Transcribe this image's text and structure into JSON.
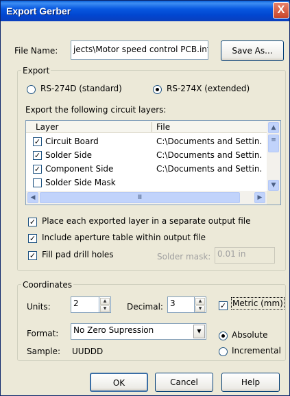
{
  "window": {
    "title": "Export Gerber",
    "close_glyph": "X"
  },
  "file": {
    "label": "File Name:",
    "value": "jects\\Motor speed control PCB.inf",
    "save_as_label": "Save As..."
  },
  "export": {
    "group_title": "Export",
    "radio_274d": "RS-274D (standard)",
    "radio_274x": "RS-274X (extended)",
    "selected_format": "RS-274X (extended)",
    "layers_label": "Export the following circuit layers:",
    "columns": [
      "Layer",
      "File"
    ],
    "layers": [
      {
        "name": "Circuit Board",
        "file": "C:\\Documents and Settin.",
        "checked": true
      },
      {
        "name": "Solder Side",
        "file": "C:\\Documents and Settin.",
        "checked": true
      },
      {
        "name": "Component Side",
        "file": "C:\\Documents and Settin.",
        "checked": true
      },
      {
        "name": "Solder Side Mask",
        "file": "",
        "checked": false
      }
    ],
    "separate_files": "Place each exported layer in a separate output file",
    "aperture_table": "Include aperture table within output file",
    "fill_pad": "Fill pad drill holes",
    "solder_mask_label": "Solder mask:",
    "solder_mask_value": "0.01 in"
  },
  "coordinates": {
    "group_title": "Coordinates",
    "units_label": "Units:",
    "units_value": "2",
    "decimal_label": "Decimal:",
    "decimal_value": "3",
    "metric_label": "Metric (mm)",
    "format_label": "Format:",
    "format_value": "No Zero Supression",
    "absolute_label": "Absolute",
    "incremental_label": "Incremental",
    "sample_label": "Sample:",
    "sample_value": "UUDDD"
  },
  "buttons": {
    "ok": "OK",
    "cancel": "Cancel",
    "help": "Help"
  },
  "colors": {
    "titlebar": "#0858e0",
    "dialog_bg": "#ece9d8",
    "close_button": "#c8452a"
  }
}
